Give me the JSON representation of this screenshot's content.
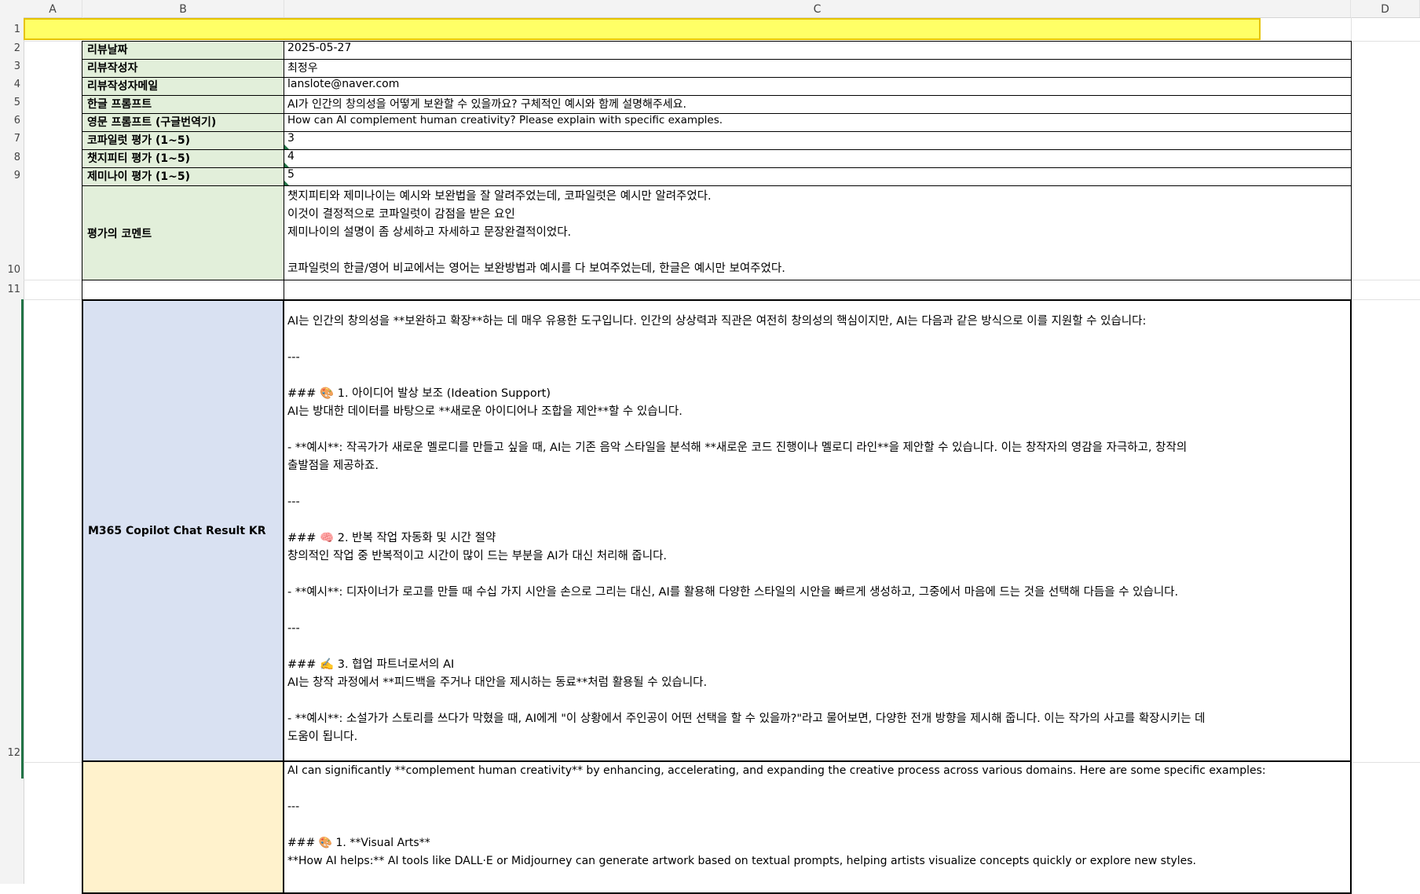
{
  "columns": [
    "A",
    "B",
    "C",
    "D"
  ],
  "rows": [
    "1",
    "2",
    "3",
    "4",
    "5",
    "6",
    "7",
    "8",
    "9",
    "10",
    "11",
    "12"
  ],
  "fields": [
    {
      "label": "리뷰날짜",
      "value": "2025-05-27"
    },
    {
      "label": "리뷰작성자",
      "value": "최정우"
    },
    {
      "label": "리뷰작성자메일",
      "value": "lanslote@naver.com"
    },
    {
      "label": "한글 프롬프트",
      "value": "AI가 인간의 창의성을 어떻게 보완할 수 있을까요? 구체적인 예시와 함께 설명해주세요."
    },
    {
      "label": "영문 프롬프트 (구글번역기)",
      "value": "How can AI complement human creativity? Please explain with specific examples."
    },
    {
      "label": "코파일럿 평가 (1~5)",
      "value": "3"
    },
    {
      "label": "챗지피티 평가 (1~5)",
      "value": "4"
    },
    {
      "label": "제미나이 평가 (1~5)",
      "value": "5"
    }
  ],
  "comment": {
    "label": "평가의 코멘트",
    "lines": [
      "챗지피티와 제미나이는 예시와 보완법을 잘 알려주었는데, 코파일럿은 예시만 알려주었다.",
      "이것이 결정적으로 코파일럿이 감점을 받은 요인",
      "제미나이의 설명이 좀 상세하고 자세하고 문장완결적이었다.",
      "",
      "코파일럿의 한글/영어 비교에서는 영어는 보완방법과 예시를 다 보여주었는데, 한글은 예시만 보여주었다."
    ]
  },
  "result_kr": {
    "label": "M365 Copilot Chat Result KR",
    "lines": [
      "AI는 인간의 창의성을 **보완하고 확장**하는 데 매우 유용한 도구입니다. 인간의 상상력과 직관은 여전히 창의성의 핵심이지만, AI는 다음과 같은 방식으로 이를 지원할 수 있습니다:",
      "",
      "---",
      "",
      "### 🎨 1. 아이디어 발상 보조 (Ideation Support)",
      "AI는 방대한 데이터를 바탕으로 **새로운 아이디어나 조합을 제안**할 수 있습니다.",
      "",
      "- **예시**: 작곡가가 새로운 멜로디를 만들고 싶을 때, AI는 기존 음악 스타일을 분석해 **새로운 코드 진행이나 멜로디 라인**을 제안할 수 있습니다. 이는 창작자의 영감을 자극하고, 창작의",
      "출발점을 제공하죠.",
      "",
      "---",
      "",
      "### 🧠 2. 반복 작업 자동화 및 시간 절약",
      "창의적인 작업 중 반복적이고 시간이 많이 드는 부분을 AI가 대신 처리해 줍니다.",
      "",
      "- **예시**: 디자이너가 로고를 만들 때 수십 가지 시안을 손으로 그리는 대신, AI를 활용해 다양한 스타일의 시안을 빠르게 생성하고, 그중에서 마음에 드는 것을 선택해 다듬을 수 있습니다.",
      "",
      "---",
      "",
      "### ✍️ 3. 협업 파트너로서의 AI",
      "AI는 창작 과정에서 **피드백을 주거나 대안을 제시하는 동료**처럼 활용될 수 있습니다.",
      "",
      "- **예시**: 소설가가 스토리를 쓰다가 막혔을 때, AI에게 \"이 상황에서 주인공이 어떤 선택을 할 수 있을까?\"라고 물어보면, 다양한 전개 방향을 제시해 줍니다. 이는 작가의 사고를 확장시키는 데",
      "도움이 됩니다.",
      "",
      "---"
    ]
  },
  "result_en": {
    "lines": [
      "AI can significantly **complement human creativity** by enhancing, accelerating, and expanding the creative process across various domains. Here are some specific examples:",
      "",
      "---",
      "",
      "### 🎨 1. **Visual Arts**",
      "**How AI helps:** AI tools like DALL·E or Midjourney can generate artwork based on textual prompts, helping artists visualize concepts quickly or explore new styles."
    ]
  },
  "colors": {
    "label_bg": "#e2efda",
    "kr_bg": "#d9e1f2",
    "en_bg": "#fff2cc",
    "row1_bg": "#ffff66",
    "header_bg": "#f3f3f3"
  }
}
